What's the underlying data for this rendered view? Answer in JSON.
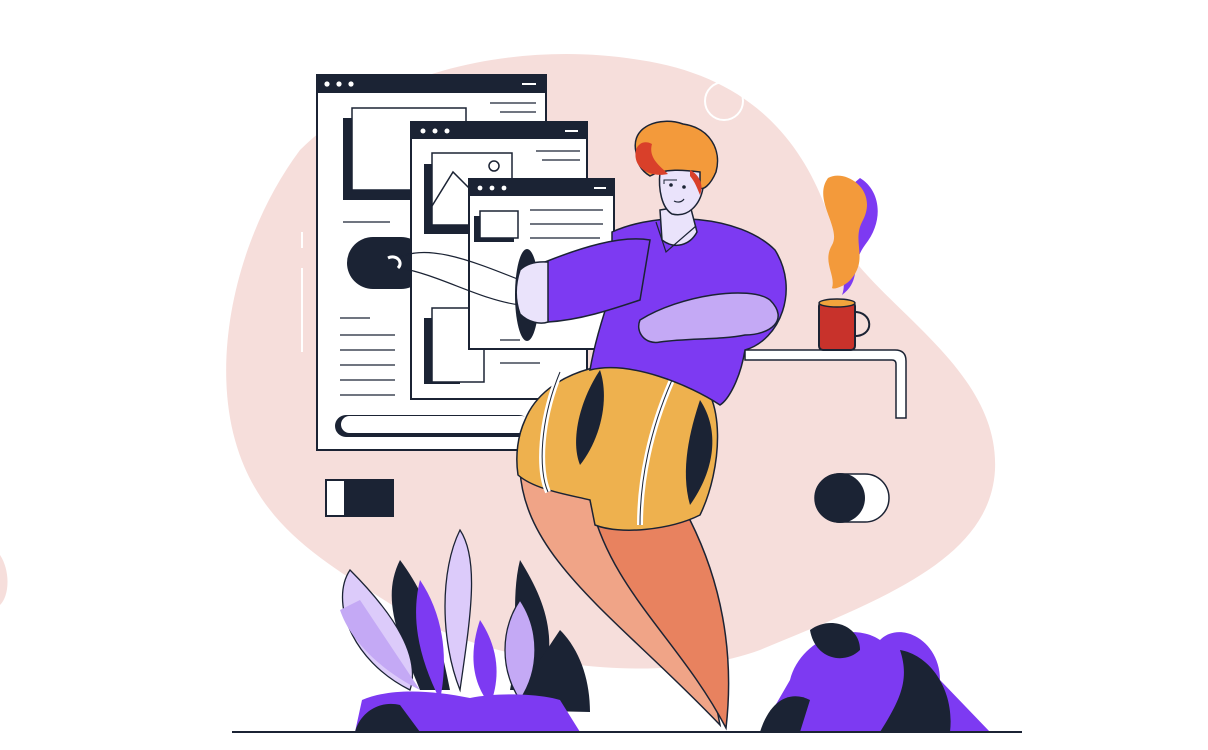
{
  "palette": {
    "blob": "#f6dedb",
    "navy": "#1b2334",
    "purple": "#7d3af2",
    "lavender": "#c4a9f5",
    "light_lavender": "#dccbfa",
    "orange_hair": "#f39a3b",
    "red_hair": "#d9402a",
    "skin": "#eae3fb",
    "shorts": "#eeb14e",
    "legs": "#f0a487",
    "mug": "#c8322b",
    "paper": "#ffffff"
  },
  "illustration": {
    "subject": "person-using-ui-windows",
    "windows": 3,
    "window_dots": 3,
    "toggle_switches": 2,
    "plants": 2
  }
}
